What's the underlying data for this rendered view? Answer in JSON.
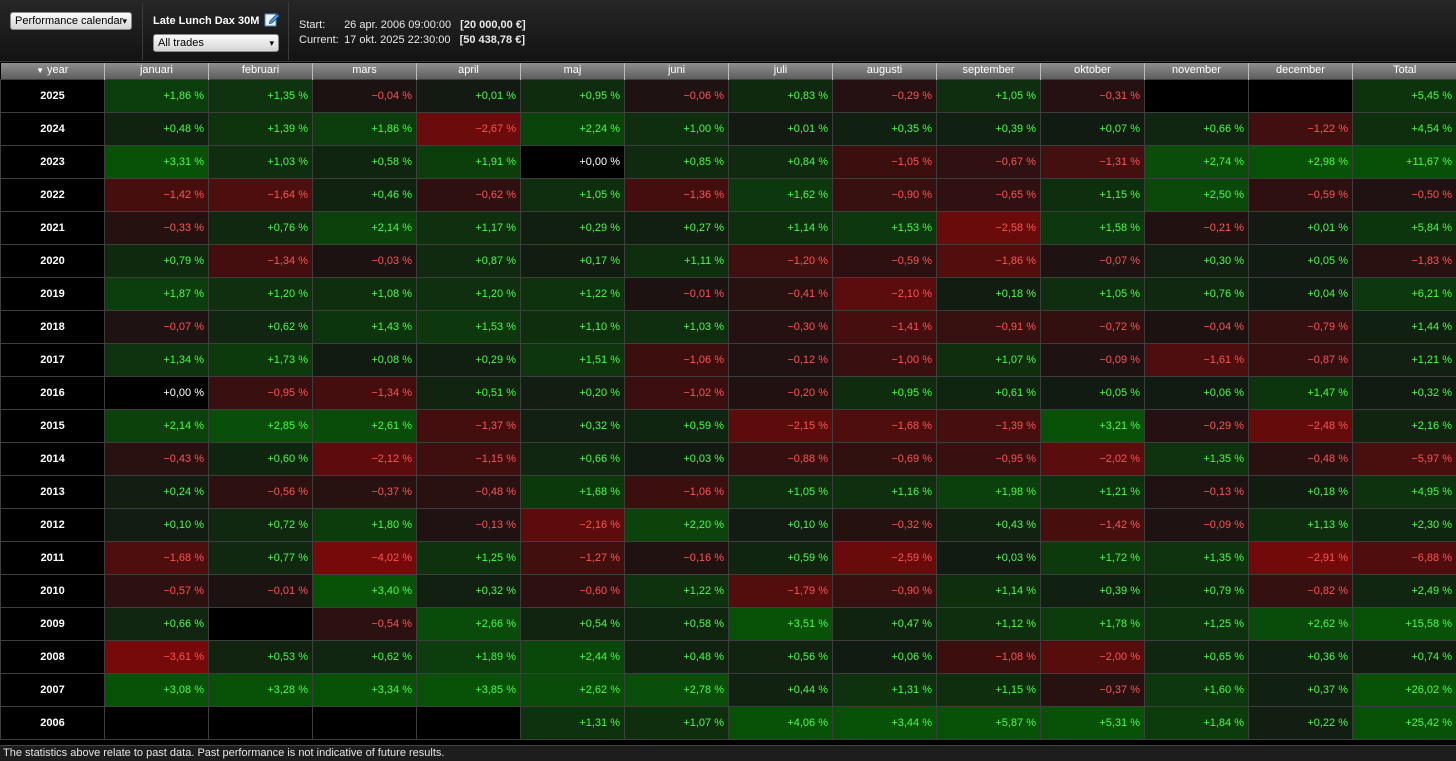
{
  "header": {
    "view_select": "Performance calendar",
    "system_name": "Late Lunch Dax 30M",
    "trades_select": "All trades",
    "start_label": "Start:",
    "start_date": "26 apr. 2006 09:00:00",
    "start_amount": "[20 000,00 €]",
    "current_label": "Current:",
    "current_date": "17 okt. 2025 22:30:00",
    "current_amount": "[50 438,78 €]"
  },
  "table": {
    "columns": [
      "year",
      "januari",
      "februari",
      "mars",
      "april",
      "maj",
      "juni",
      "juli",
      "augusti",
      "september",
      "oktober",
      "november",
      "december",
      "Total"
    ],
    "sort_icon": "triangle-down-icon",
    "rows": [
      {
        "year": "2025",
        "cells": [
          "+1,86 %",
          "+1,35 %",
          "−0,04 %",
          "+0,01 %",
          "+0,95 %",
          "−0,06 %",
          "+0,83 %",
          "−0,29 %",
          "+1,05 %",
          "−0,31 %",
          "",
          "",
          "+5,45 %"
        ]
      },
      {
        "year": "2024",
        "cells": [
          "+0,48 %",
          "+1,39 %",
          "+1,86 %",
          "−2,67 %",
          "+2,24 %",
          "+1,00 %",
          "+0,01 %",
          "+0,35 %",
          "+0,39 %",
          "+0,07 %",
          "+0,66 %",
          "−1,22 %",
          "+4,54 %"
        ]
      },
      {
        "year": "2023",
        "cells": [
          "+3,31 %",
          "+1,03 %",
          "+0,58 %",
          "+1,91 %",
          "+0,00 %",
          "+0,85 %",
          "+0,84 %",
          "−1,05 %",
          "−0,67 %",
          "−1,31 %",
          "+2,74 %",
          "+2,98 %",
          "+11,67 %"
        ]
      },
      {
        "year": "2022",
        "cells": [
          "−1,42 %",
          "−1,64 %",
          "+0,46 %",
          "−0,62 %",
          "+1,05 %",
          "−1,36 %",
          "+1,62 %",
          "−0,90 %",
          "−0,65 %",
          "+1,15 %",
          "+2,50 %",
          "−0,59 %",
          "−0,50 %"
        ]
      },
      {
        "year": "2021",
        "cells": [
          "−0,33 %",
          "+0,76 %",
          "+2,14 %",
          "+1,17 %",
          "+0,29 %",
          "+0,27 %",
          "+1,14 %",
          "+1,53 %",
          "−2,58 %",
          "+1,58 %",
          "−0,21 %",
          "+0,01 %",
          "+5,84 %"
        ]
      },
      {
        "year": "2020",
        "cells": [
          "+0,79 %",
          "−1,34 %",
          "−0,03 %",
          "+0,87 %",
          "+0,17 %",
          "+1,11 %",
          "−1,20 %",
          "−0,59 %",
          "−1,86 %",
          "−0,07 %",
          "+0,30 %",
          "+0,05 %",
          "−1,83 %"
        ]
      },
      {
        "year": "2019",
        "cells": [
          "+1,87 %",
          "+1,20 %",
          "+1,08 %",
          "+1,20 %",
          "+1,22 %",
          "−0,01 %",
          "−0,41 %",
          "−2,10 %",
          "+0,18 %",
          "+1,05 %",
          "+0,76 %",
          "+0,04 %",
          "+6,21 %"
        ]
      },
      {
        "year": "2018",
        "cells": [
          "−0,07 %",
          "+0,62 %",
          "+1,43 %",
          "+1,53 %",
          "+1,10 %",
          "+1,03 %",
          "−0,30 %",
          "−1,41 %",
          "−0,91 %",
          "−0,72 %",
          "−0,04 %",
          "−0,79 %",
          "+1,44 %"
        ]
      },
      {
        "year": "2017",
        "cells": [
          "+1,34 %",
          "+1,73 %",
          "+0,08 %",
          "+0,29 %",
          "+1,51 %",
          "−1,06 %",
          "−0,12 %",
          "−1,00 %",
          "+1,07 %",
          "−0,09 %",
          "−1,61 %",
          "−0,87 %",
          "+1,21 %"
        ]
      },
      {
        "year": "2016",
        "cells": [
          "+0,00 %",
          "−0,95 %",
          "−1,34 %",
          "+0,51 %",
          "+0,20 %",
          "−1,02 %",
          "−0,20 %",
          "+0,95 %",
          "+0,61 %",
          "+0,05 %",
          "+0,06 %",
          "+1,47 %",
          "+0,32 %"
        ]
      },
      {
        "year": "2015",
        "cells": [
          "+2,14 %",
          "+2,85 %",
          "+2,61 %",
          "−1,37 %",
          "+0,32 %",
          "+0,59 %",
          "−2,15 %",
          "−1,68 %",
          "−1,39 %",
          "+3,21 %",
          "−0,29 %",
          "−2,48 %",
          "+2,16 %"
        ]
      },
      {
        "year": "2014",
        "cells": [
          "−0,43 %",
          "+0,60 %",
          "−2,12 %",
          "−1,15 %",
          "+0,66 %",
          "+0,03 %",
          "−0,88 %",
          "−0,69 %",
          "−0,95 %",
          "−2,02 %",
          "+1,35 %",
          "−0,48 %",
          "−5,97 %"
        ]
      },
      {
        "year": "2013",
        "cells": [
          "+0,24 %",
          "−0,56 %",
          "−0,37 %",
          "−0,48 %",
          "+1,68 %",
          "−1,06 %",
          "+1,05 %",
          "+1,16 %",
          "+1,98 %",
          "+1,21 %",
          "−0,13 %",
          "+0,18 %",
          "+4,95 %"
        ]
      },
      {
        "year": "2012",
        "cells": [
          "+0,10 %",
          "+0,72 %",
          "+1,80 %",
          "−0,13 %",
          "−2,16 %",
          "+2,20 %",
          "+0,10 %",
          "−0,32 %",
          "+0,43 %",
          "−1,42 %",
          "−0,09 %",
          "+1,13 %",
          "+2,30 %"
        ]
      },
      {
        "year": "2011",
        "cells": [
          "−1,68 %",
          "+0,77 %",
          "−4,02 %",
          "+1,25 %",
          "−1,27 %",
          "−0,16 %",
          "+0,59 %",
          "−2,59 %",
          "+0,03 %",
          "+1,72 %",
          "+1,35 %",
          "−2,91 %",
          "−6,88 %"
        ]
      },
      {
        "year": "2010",
        "cells": [
          "−0,57 %",
          "−0,01 %",
          "+3,40 %",
          "+0,32 %",
          "−0,60 %",
          "+1,22 %",
          "−1,79 %",
          "−0,90 %",
          "+1,14 %",
          "+0,39 %",
          "+0,79 %",
          "−0,82 %",
          "+2,49 %"
        ]
      },
      {
        "year": "2009",
        "cells": [
          "+0,66 %",
          "",
          "−0,54 %",
          "+2,66 %",
          "+0,54 %",
          "+0,58 %",
          "+3,51 %",
          "+0,47 %",
          "+1,12 %",
          "+1,78 %",
          "+1,25 %",
          "+2,62 %",
          "+15,58 %"
        ]
      },
      {
        "year": "2008",
        "cells": [
          "−3,61 %",
          "+0,53 %",
          "+0,62 %",
          "+1,89 %",
          "+2,44 %",
          "+0,48 %",
          "+0,56 %",
          "+0,06 %",
          "−1,08 %",
          "−2,00 %",
          "+0,65 %",
          "+0,36 %",
          "+0,74 %"
        ]
      },
      {
        "year": "2007",
        "cells": [
          "+3,08 %",
          "+3,28 %",
          "+3,34 %",
          "+3,85 %",
          "+2,62 %",
          "+2,78 %",
          "+0,44 %",
          "+1,31 %",
          "+1,15 %",
          "−0,37 %",
          "+1,60 %",
          "+0,37 %",
          "+26,02 %"
        ]
      },
      {
        "year": "2006",
        "cells": [
          "",
          "",
          "",
          "",
          "+1,31 %",
          "+1,07 %",
          "+4,06 %",
          "+3,44 %",
          "+5,87 %",
          "+5,31 %",
          "+1,84 %",
          "+0,22 %",
          "+25,42 %"
        ]
      }
    ]
  },
  "colors": {
    "positive_text": "#41ff41",
    "negative_text": "#ff5252",
    "positive_bg": "#0a4a0a",
    "negative_bg": "#5a0a0a",
    "neutral_bg": "#000000"
  },
  "footer": {
    "disclaimer": "The statistics above relate to past data. Past performance is not indicative of future results."
  }
}
